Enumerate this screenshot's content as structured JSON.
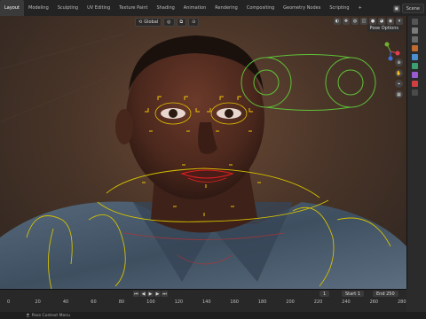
{
  "workspace_tabs": [
    "Layout",
    "Modeling",
    "Sculpting",
    "UV Editing",
    "Texture Paint",
    "Shading",
    "Animation",
    "Rendering",
    "Compositing",
    "Geometry Nodes",
    "Scripting",
    "+"
  ],
  "active_tab": "Layout",
  "scene": {
    "label": "Scene"
  },
  "viewport": {
    "orientation": "Global",
    "pose_options": "Pose Options"
  },
  "timeline": {
    "current_frame": "1",
    "start_label": "Start",
    "start_value": "1",
    "end_label": "End",
    "end_value": "250",
    "ticks": [
      "0",
      "20",
      "40",
      "60",
      "80",
      "100",
      "120",
      "140",
      "160",
      "180",
      "200",
      "220",
      "240",
      "260",
      "280"
    ]
  },
  "statusbar": {
    "hint": "Pose Context Menu"
  }
}
